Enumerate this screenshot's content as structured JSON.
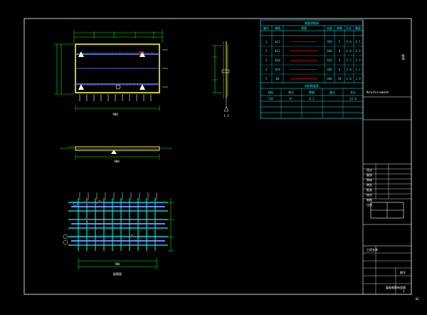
{
  "drawing": {
    "background": "#000000",
    "colors": {
      "frame": "#ffffff",
      "outline": "#ffff00",
      "dim": "#00ff00",
      "rebar": "#00ffff",
      "rebar_alt": "#8080ff",
      "mark": "#ff0000",
      "table": "#00ffff"
    }
  },
  "views": {
    "plan_label": "平面",
    "plan_width": "900",
    "section_label": "1-1",
    "elevation_width": "900",
    "rebar_label": "配筋图",
    "rebar_width": "900"
  },
  "table": {
    "title": "钢筋明细表",
    "header": [
      "编号",
      "规格",
      "简图",
      "长度",
      "根数",
      "总长",
      "重量"
    ],
    "rows": [
      [
        "1",
        "Φ12",
        "",
        "920",
        "5",
        "4.6",
        "4.1"
      ],
      [
        "2",
        "Φ12",
        "",
        "600",
        "8",
        "4.8",
        "4.3"
      ],
      [
        "3",
        "Φ10",
        "",
        "920",
        "4",
        "3.7",
        "2.3"
      ],
      [
        "4",
        "Φ10",
        "",
        "600",
        "6",
        "3.6",
        "2.2"
      ],
      [
        "5",
        "Φ8",
        "",
        "480",
        "10",
        "4.8",
        "1.9"
      ]
    ],
    "subtitle": "材料数量表",
    "sub_header": [
      "材料",
      "单位",
      "数量",
      "备注",
      "合计"
    ],
    "sub_row": [
      "C30",
      "m³",
      "0.2",
      "",
      "14.8"
    ]
  },
  "notes": {
    "side_text": "说明",
    "side_line": "Reinforcement"
  },
  "titleblock": {
    "labels": [
      "设计",
      "复核",
      "审核",
      "审定",
      "批准",
      "校对",
      "制图",
      "比例"
    ],
    "project": "工程名称",
    "drawing_title": "盖板钢筋构造图",
    "sheet": "图号",
    "sheet_no": "1",
    "page": "01"
  }
}
